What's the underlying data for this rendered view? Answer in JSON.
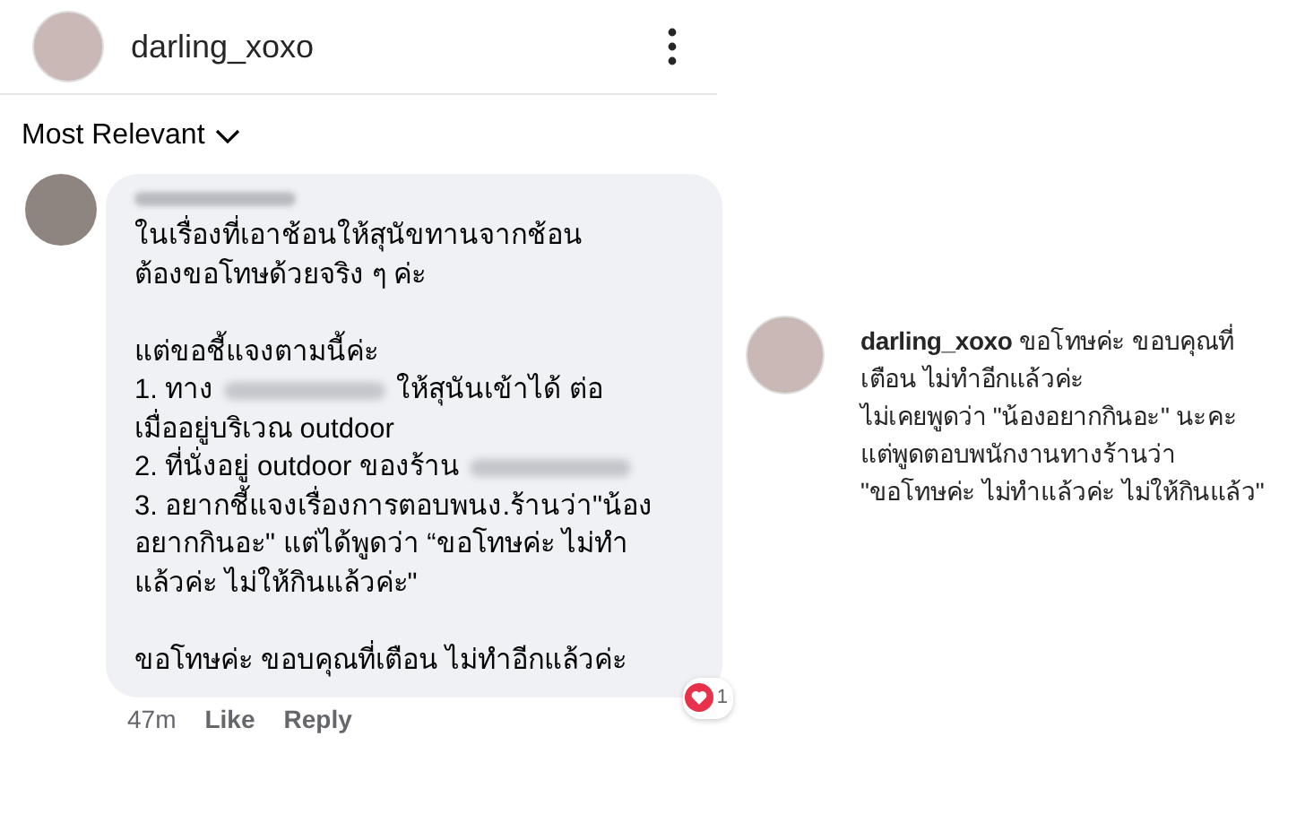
{
  "post_header": {
    "username": "darling_xoxo"
  },
  "sort": {
    "label": "Most Relevant"
  },
  "comment": {
    "author_redacted": true,
    "paragraphs": [
      [
        [
          {
            "kind": "text",
            "text": "ในเรื่องที่เอาช้อนให้สุนัขทานจากช้อน"
          }
        ],
        [
          {
            "kind": "text",
            "text": "ต้องขอโทษด้วยจริง ๆ ค่ะ"
          }
        ]
      ],
      [
        [
          {
            "kind": "text",
            "text": "แต่ขอชี้แจงตามนี้ค่ะ"
          }
        ],
        [
          {
            "kind": "text",
            "text": "1. ทาง"
          },
          {
            "kind": "redacted"
          },
          {
            "kind": "text",
            "text": "ให้สุนันเข้าได้ ต่อ"
          }
        ],
        [
          {
            "kind": "text",
            "text": "เมื่ออยู่บริเวณ outdoor"
          }
        ],
        [
          {
            "kind": "text",
            "text": "2. ที่นั่งอยู่ outdoor ของร้าน"
          },
          {
            "kind": "redacted"
          }
        ],
        [
          {
            "kind": "text",
            "text": "3. อยากชี้แจงเรื่องการตอบพนง.ร้านว่า\"น้อง"
          }
        ],
        [
          {
            "kind": "text",
            "text": "อยากกินอะ\" แต่ได้พูดว่า “ขอโทษค่ะ ไม่ทำ"
          }
        ],
        [
          {
            "kind": "text",
            "text": "แล้วค่ะ ไม่ให้กินแล้วค่ะ\""
          }
        ]
      ],
      [
        [
          {
            "kind": "text",
            "text": "ขอโทษค่ะ ขอบคุณที่เตือน ไม่ทำอีกแล้วค่ะ"
          }
        ]
      ]
    ],
    "time": "47m",
    "actions": [
      "Like",
      "Reply"
    ],
    "reaction_count": "1"
  },
  "reply": {
    "username": "darling_xoxo",
    "lines": [
      "ขอโทษค่ะ ขอบคุณที่",
      "เตือน ไม่ทำอีกแล้วค่ะ",
      "ไม่เคยพูดว่า \"น้องอยากกินอะ\" นะคะ",
      "แต่พูดตอบพนักงานทางร้านว่า",
      "\"ขอโทษค่ะ ไม่ทำแล้วค่ะ ไม่ให้กินแล้ว\""
    ]
  }
}
